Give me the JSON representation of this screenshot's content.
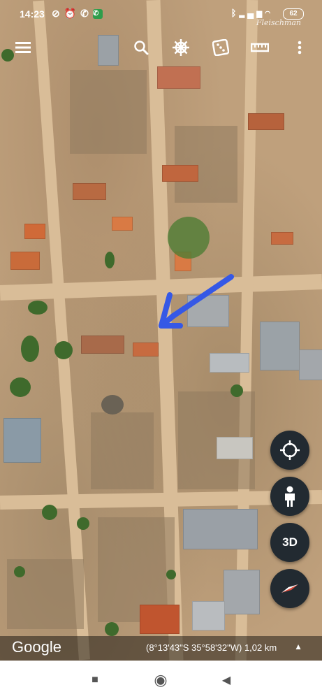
{
  "status_bar": {
    "time": "14:23",
    "left_icons": [
      "wifi-off-icon",
      "alarm-icon",
      "phone-icon",
      "whatsapp-icon"
    ],
    "right_icons": [
      "bluetooth-icon",
      "signal-icon",
      "signal-icon",
      "wifi-icon"
    ],
    "battery": "62"
  },
  "watermark": "Fleischman",
  "toolbar": {
    "menu_icon": "menu-icon",
    "search_icon": "search-icon",
    "voyager_icon": "ship-wheel-icon",
    "feeling_lucky_icon": "dice-icon",
    "measure_icon": "ruler-icon",
    "more_icon": "more-vert-icon"
  },
  "map": {
    "arrow_color": "#3558e6"
  },
  "fabs": {
    "location_icon": "crosshair-icon",
    "pegman_icon": "person-icon",
    "three_d_label": "3D",
    "compass_icon": "compass-icon"
  },
  "bottom_bar": {
    "logo": "Google",
    "coords": "(8°13'43\"S 35°58'32\"W) 1,02 km",
    "caret": "▲"
  },
  "nav": {
    "recent": "■",
    "home": "◉",
    "back": "◀"
  }
}
